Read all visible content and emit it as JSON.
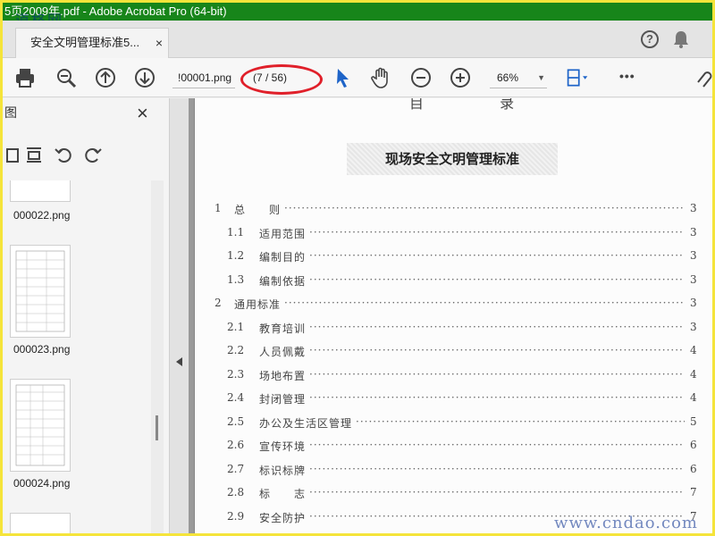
{
  "window": {
    "title": "5页2009年.pdf - Adobe Acrobat Pro (64-bit)"
  },
  "watermark": {
    "top_left": "道格网",
    "bottom_right": "www.cndao.com"
  },
  "tab": {
    "label": "安全文明管理标准5...",
    "close": "×"
  },
  "header": {
    "help": "?"
  },
  "toolbar": {
    "page_name": "!00001.png",
    "page_count": "(7 / 56)",
    "zoom": "66%",
    "more": "•••"
  },
  "sidebar": {
    "title": "图",
    "close": "×",
    "thumbnails": [
      {
        "label": "000022.png"
      },
      {
        "label": "000023.png"
      },
      {
        "label": "000024.png"
      }
    ]
  },
  "document": {
    "title": "现场安全文明管理标准",
    "toc": [
      {
        "num": "1",
        "text": "总　　则",
        "page": "3"
      },
      {
        "num": "1.1",
        "text": "适用范围",
        "page": "3"
      },
      {
        "num": "1.2",
        "text": "编制目的",
        "page": "3"
      },
      {
        "num": "1.3",
        "text": "编制依据",
        "page": "3"
      },
      {
        "num": "2",
        "text": "通用标准",
        "page": "3"
      },
      {
        "num": "2.1",
        "text": "教育培训",
        "page": "3"
      },
      {
        "num": "2.2",
        "text": "人员佩戴",
        "page": "4"
      },
      {
        "num": "2.3",
        "text": "场地布置",
        "page": "4"
      },
      {
        "num": "2.4",
        "text": "封闭管理",
        "page": "4"
      },
      {
        "num": "2.5",
        "text": "办公及生活区管理",
        "page": "5"
      },
      {
        "num": "2.6",
        "text": "宣传环境",
        "page": "6"
      },
      {
        "num": "2.7",
        "text": "标识标牌",
        "page": "6"
      },
      {
        "num": "2.8",
        "text": "标　　志",
        "page": "7"
      },
      {
        "num": "2.9",
        "text": "安全防护",
        "page": "7"
      }
    ]
  },
  "colors": {
    "titlebar": "#17851a",
    "annotation": "#e0202a",
    "cursor": "#1e64c8",
    "frame": "#f5e43a"
  }
}
